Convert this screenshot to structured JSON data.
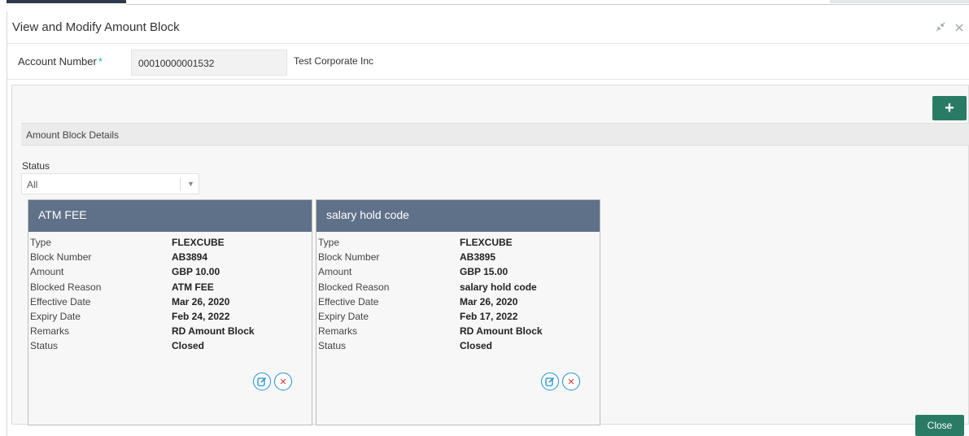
{
  "dialog": {
    "title": "View and Modify Amount Block",
    "window_icons": [
      "minimize-icon",
      "close-icon"
    ]
  },
  "account": {
    "label": "Account Number",
    "required_mark": "*",
    "number": "00010000001532",
    "name": "Test Corporate Inc"
  },
  "panel": {
    "add_button_label": "+",
    "section_title": "Amount Block Details",
    "status_label": "Status",
    "status_selected": "All"
  },
  "cards": [
    {
      "title": "ATM FEE",
      "rows": [
        {
          "key": "Type",
          "value": "FLEXCUBE"
        },
        {
          "key": "Block Number",
          "value": "AB3894"
        },
        {
          "key": "Amount",
          "value": "GBP 10.00"
        },
        {
          "key": "Blocked Reason",
          "value": "ATM FEE"
        },
        {
          "key": "Effective Date",
          "value": "Mar 26, 2020"
        },
        {
          "key": "Expiry Date",
          "value": "Feb 24, 2022"
        },
        {
          "key": "Remarks",
          "value": "RD Amount Block"
        },
        {
          "key": "Status",
          "value": "Closed"
        }
      ]
    },
    {
      "title": "salary hold code",
      "rows": [
        {
          "key": "Type",
          "value": "FLEXCUBE"
        },
        {
          "key": "Block Number",
          "value": "AB3895"
        },
        {
          "key": "Amount",
          "value": "GBP 15.00"
        },
        {
          "key": "Blocked Reason",
          "value": "salary hold code"
        },
        {
          "key": "Effective Date",
          "value": "Mar 26, 2020"
        },
        {
          "key": "Expiry Date",
          "value": "Feb 17, 2022"
        },
        {
          "key": "Remarks",
          "value": "RD Amount Block"
        },
        {
          "key": "Status",
          "value": "Closed"
        }
      ]
    }
  ],
  "footer": {
    "close_label": "Close"
  },
  "colors": {
    "accent_green": "#2a7b66",
    "card_header": "#5f7188",
    "required": "#1abc9c",
    "edit_icon": "#1e8fd0",
    "delete_icon": "#d0342c"
  }
}
